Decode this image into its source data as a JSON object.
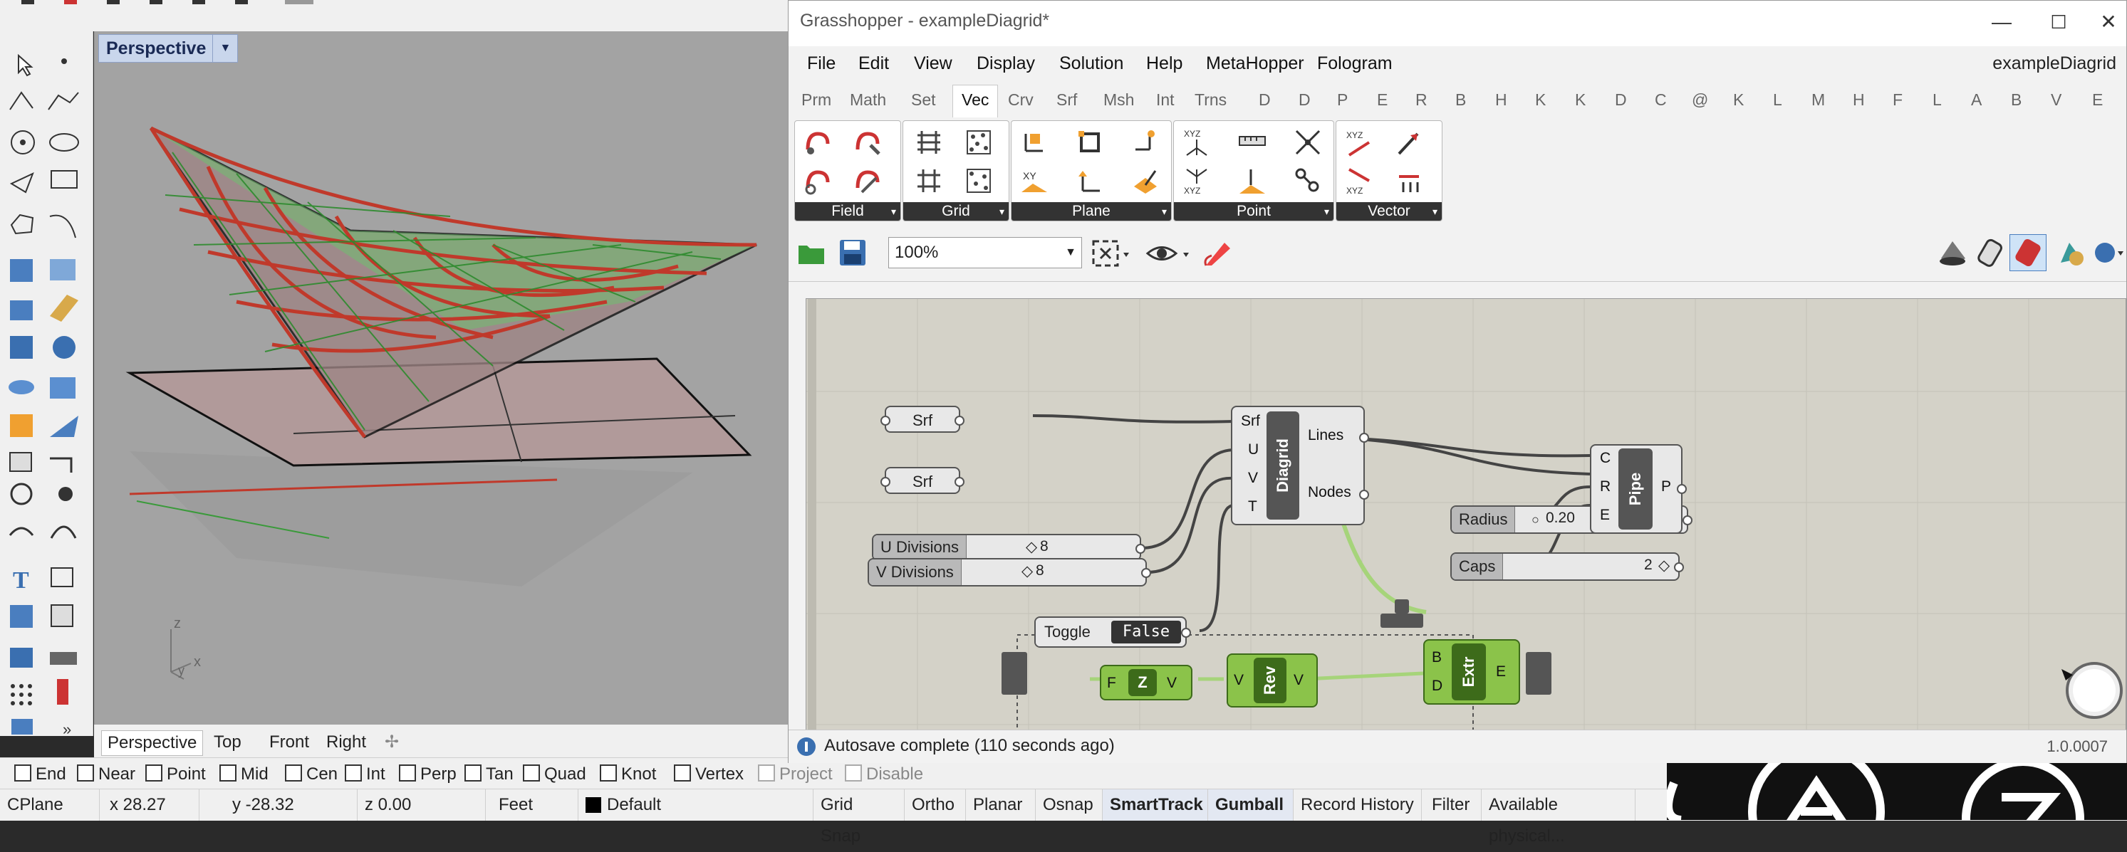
{
  "rhino": {
    "viewport_title": "Perspective",
    "axes": {
      "z": "z",
      "x": "x",
      "y": "y"
    },
    "view_tabs": [
      "Perspective",
      "Top",
      "Front",
      "Right"
    ],
    "osnaps": [
      {
        "label": "End",
        "checked": false
      },
      {
        "label": "Near",
        "checked": false
      },
      {
        "label": "Point",
        "checked": false
      },
      {
        "label": "Mid",
        "checked": false
      },
      {
        "label": "Cen",
        "checked": false
      },
      {
        "label": "Int",
        "checked": false
      },
      {
        "label": "Perp",
        "checked": false
      },
      {
        "label": "Tan",
        "checked": false
      },
      {
        "label": "Quad",
        "checked": false
      },
      {
        "label": "Knot",
        "checked": false
      },
      {
        "label": "Vertex",
        "checked": false
      },
      {
        "label": "Project",
        "checked": false
      },
      {
        "label": "Disable",
        "checked": false
      }
    ],
    "status": {
      "cplane": "CPlane",
      "x": "x 28.27",
      "y": "y -28.32",
      "z": "z 0.00",
      "units": "Feet",
      "layer": "Default",
      "grid_snap": "Grid Snap",
      "ortho": "Ortho",
      "planar": "Planar",
      "osnap": "Osnap",
      "smarttrack": "SmartTrack",
      "gumball": "Gumball",
      "record_history": "Record History",
      "filter": "Filter",
      "memory": "Available physical..."
    },
    "colors": {
      "viewport_bg": "#a3a3a3",
      "surface_green": "#4caf50",
      "pipe_red": "#c0392b"
    }
  },
  "grasshopper": {
    "window_title": "Grasshopper - exampleDiagrid*",
    "window_controls": {
      "minimize": "—",
      "maximize": "☐",
      "close": "✕"
    },
    "menu": [
      "File",
      "Edit",
      "View",
      "Display",
      "Solution",
      "Help",
      "MetaHopper",
      "Fologram"
    ],
    "document_name": "exampleDiagrid",
    "tabs": [
      "Prm",
      "Math",
      "Set",
      "Vec",
      "Crv",
      "Srf",
      "Msh",
      "Int",
      "Trns",
      "D",
      "D",
      "P",
      "E",
      "R",
      "B",
      "H",
      "K",
      "K",
      "D",
      "C",
      "@",
      "K",
      "L",
      "M",
      "H",
      "F",
      "L",
      "A",
      "B",
      "V",
      "E"
    ],
    "active_tab": "Vec",
    "ribbon_panels": [
      "Field",
      "Grid",
      "Plane",
      "Point",
      "Vector"
    ],
    "zoom": "100%",
    "canvas": {
      "srf1": "Srf",
      "srf2": "Srf",
      "u_divisions": {
        "label": "U Divisions",
        "value": "8"
      },
      "v_divisions": {
        "label": "V Divisions",
        "value": "8"
      },
      "toggle": {
        "label": "Toggle",
        "value": "False"
      },
      "diagrid": {
        "name": "Diagrid",
        "inputs": [
          "Srf",
          "U",
          "V",
          "T"
        ],
        "outputs": [
          "Lines",
          "Nodes"
        ]
      },
      "radius": {
        "label": "Radius",
        "value": "0.20"
      },
      "caps": {
        "label": "Caps",
        "value": "2"
      },
      "pipe": {
        "name": "Pipe",
        "inputs": [
          "C",
          "R",
          "E"
        ],
        "outputs": [
          "P"
        ]
      },
      "z": {
        "name": "Z",
        "inputs": [
          "F"
        ],
        "outputs": [
          "V"
        ]
      },
      "rev": {
        "name": "Rev",
        "inputs": [
          "V"
        ],
        "outputs": [
          "V"
        ]
      },
      "extr": {
        "name": "Extr",
        "inputs": [
          "B",
          "D"
        ],
        "outputs": [
          "E"
        ]
      }
    },
    "status": "Autosave complete (110 seconds ago)",
    "version": "1.0.0007",
    "colors": {
      "canvas": "#d4d2c8",
      "component": "#e8e8e8",
      "selected": "#8bc34a"
    }
  }
}
